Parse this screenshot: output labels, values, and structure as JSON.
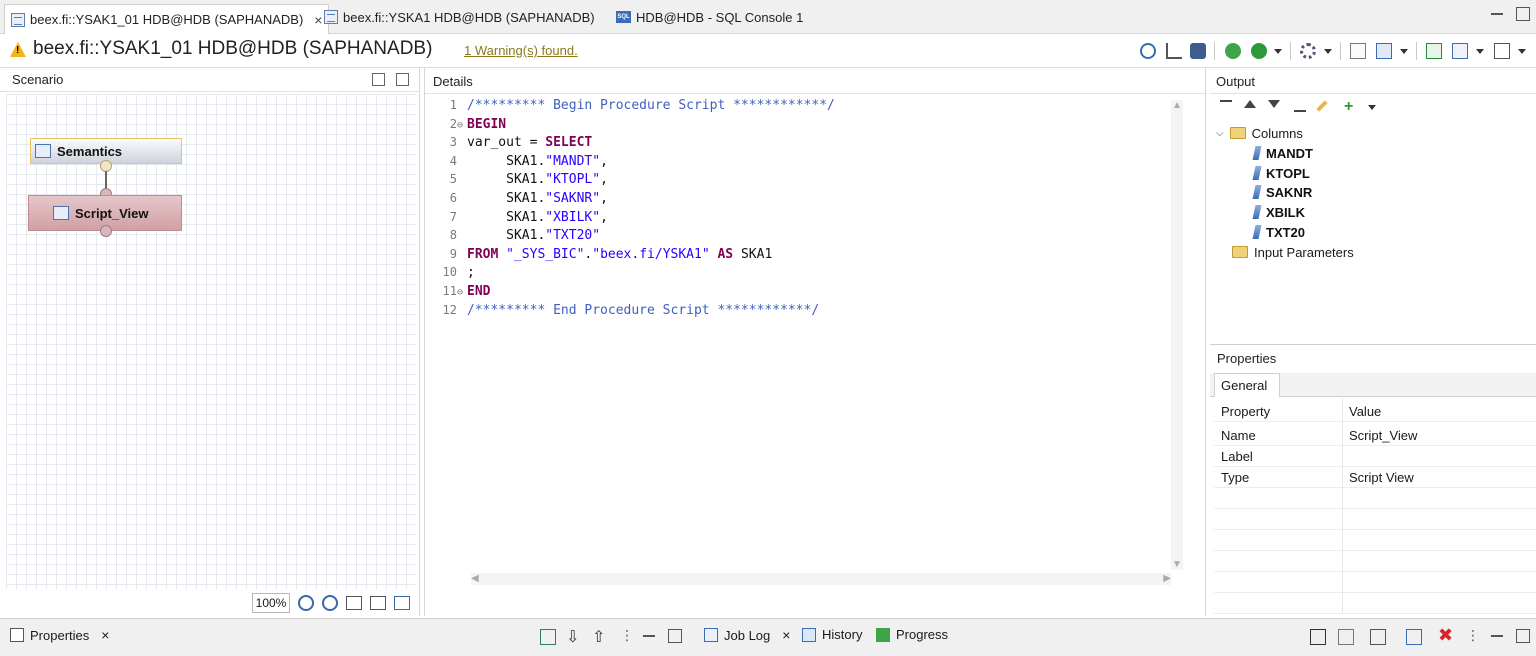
{
  "tabs": [
    {
      "label": "beex.fi::YSAK1_01 HDB@HDB (SAPHANADB)",
      "icon": "calc-view-icon",
      "active": true
    },
    {
      "label": "beex.fi::YSKA1 HDB@HDB (SAPHANADB)",
      "icon": "calc-view-icon",
      "active": false
    },
    {
      "label": "HDB@HDB - SQL Console 1",
      "icon": "sql-console-icon",
      "active": false
    }
  ],
  "tab_close": "×",
  "editor": {
    "title": "beex.fi::YSAK1_01 HDB@HDB (SAPHANADB)",
    "warning": "1 Warning(s) found."
  },
  "scenario": {
    "title": "Scenario",
    "nodes": [
      {
        "label": "Semantics"
      },
      {
        "label": "Script_View"
      }
    ],
    "zoom": "100%"
  },
  "details": {
    "title": "Details",
    "lines": [
      {
        "n": "1",
        "fold": "",
        "parts": [
          {
            "c": "cm",
            "t": "/********* Begin Procedure Script ************/"
          }
        ]
      },
      {
        "n": "2",
        "fold": "⊖",
        "parts": [
          {
            "c": "kw",
            "t": "BEGIN"
          }
        ]
      },
      {
        "n": "3",
        "fold": "",
        "parts": [
          {
            "c": "tx",
            "t": "var_out = "
          },
          {
            "c": "kw",
            "t": "SELECT"
          }
        ]
      },
      {
        "n": "4",
        "fold": "",
        "parts": [
          {
            "c": "tx",
            "t": "     SKA1."
          },
          {
            "c": "st",
            "t": "\"MANDT\""
          },
          {
            "c": "tx",
            "t": ","
          }
        ]
      },
      {
        "n": "5",
        "fold": "",
        "parts": [
          {
            "c": "tx",
            "t": "     SKA1."
          },
          {
            "c": "st",
            "t": "\"KTOPL\""
          },
          {
            "c": "tx",
            "t": ","
          }
        ]
      },
      {
        "n": "6",
        "fold": "",
        "parts": [
          {
            "c": "tx",
            "t": "     SKA1."
          },
          {
            "c": "st",
            "t": "\"SAKNR\""
          },
          {
            "c": "tx",
            "t": ","
          }
        ]
      },
      {
        "n": "7",
        "fold": "",
        "parts": [
          {
            "c": "tx",
            "t": "     SKA1."
          },
          {
            "c": "st",
            "t": "\"XBILK\""
          },
          {
            "c": "tx",
            "t": ","
          }
        ]
      },
      {
        "n": "8",
        "fold": "",
        "parts": [
          {
            "c": "tx",
            "t": "     SKA1."
          },
          {
            "c": "st",
            "t": "\"TXT20\""
          }
        ]
      },
      {
        "n": "9",
        "fold": "",
        "parts": [
          {
            "c": "kw",
            "t": "FROM "
          },
          {
            "c": "st",
            "t": "\"_SYS_BIC\""
          },
          {
            "c": "tx",
            "t": "."
          },
          {
            "c": "st",
            "t": "\"beex.fi/YSKA1\""
          },
          {
            "c": "kw",
            "t": " AS "
          },
          {
            "c": "tx",
            "t": "SKA1"
          }
        ]
      },
      {
        "n": "10",
        "fold": "",
        "parts": [
          {
            "c": "tx",
            "t": ";"
          }
        ]
      },
      {
        "n": "11",
        "fold": "⊖",
        "parts": [
          {
            "c": "kw",
            "t": "END"
          }
        ]
      },
      {
        "n": "12",
        "fold": "",
        "parts": [
          {
            "c": "cm",
            "t": "/********* End Procedure Script ************/"
          }
        ]
      }
    ]
  },
  "output": {
    "title": "Output",
    "columns_label": "Columns",
    "columns": [
      "MANDT",
      "KTOPL",
      "SAKNR",
      "XBILK",
      "TXT20"
    ],
    "input_params_label": "Input Parameters"
  },
  "properties": {
    "title": "Properties",
    "tab": "General",
    "header": {
      "property": "Property",
      "value": "Value"
    },
    "rows": [
      {
        "property": "Name",
        "value": "Script_View"
      },
      {
        "property": "Label",
        "value": ""
      },
      {
        "property": "Type",
        "value": "Script View"
      }
    ]
  },
  "bottom": {
    "properties_tab": "Properties",
    "job_log_tab": "Job Log",
    "history_tab": "History",
    "progress_tab": "Progress"
  },
  "colors": {
    "keyword": "#7f0055",
    "string": "#2a00ff",
    "comment": "#3f5fbf",
    "warning": "#f2b51c",
    "script_node": "#cfa1a6",
    "semantics_border": "#e8c460"
  }
}
